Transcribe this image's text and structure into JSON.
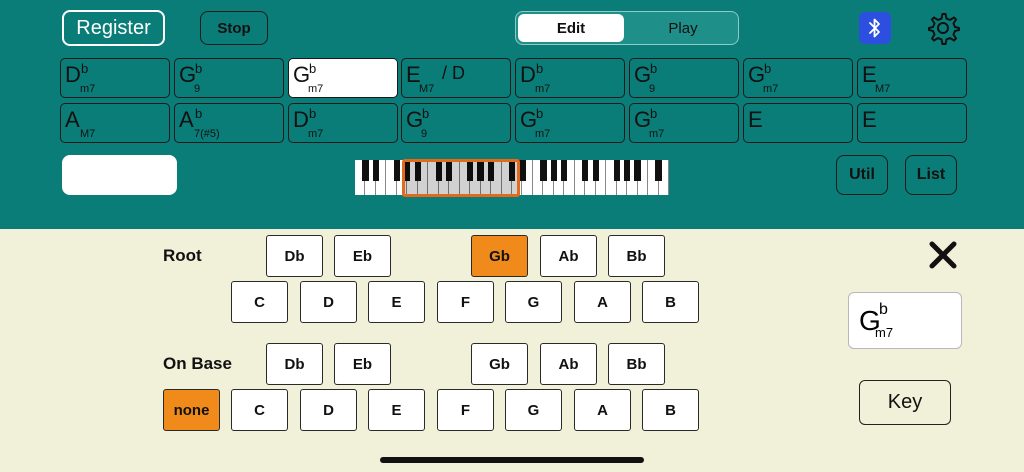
{
  "header": {
    "register_label": "Register",
    "stop_label": "Stop",
    "mode": {
      "options": [
        "Edit",
        "Play"
      ],
      "selected": "Edit"
    },
    "util_label": "Util",
    "list_label": "List"
  },
  "chords": [
    [
      {
        "root": "D",
        "acc": "b",
        "qual": "m7"
      },
      {
        "root": "G",
        "acc": "b",
        "qual": "9"
      },
      {
        "root": "G",
        "acc": "b",
        "qual": "m7",
        "selected": true
      },
      {
        "root": "E",
        "acc": "",
        "qual": "M7",
        "slash": "/ D"
      },
      {
        "root": "D",
        "acc": "b",
        "qual": "m7"
      },
      {
        "root": "G",
        "acc": "b",
        "qual": "9"
      },
      {
        "root": "G",
        "acc": "b",
        "qual": "m7"
      },
      {
        "root": "E",
        "acc": "",
        "qual": "M7"
      }
    ],
    [
      {
        "root": "A",
        "acc": "",
        "qual": "M7"
      },
      {
        "root": "A",
        "acc": "b",
        "qual": "7(#5)"
      },
      {
        "root": "D",
        "acc": "b",
        "qual": "m7"
      },
      {
        "root": "G",
        "acc": "b",
        "qual": "9"
      },
      {
        "root": "G",
        "acc": "b",
        "qual": "m7"
      },
      {
        "root": "G",
        "acc": "b",
        "qual": "m7"
      },
      {
        "root": "E",
        "acc": "",
        "qual": ""
      },
      {
        "root": "E",
        "acc": "",
        "qual": ""
      }
    ]
  ],
  "root_section": {
    "label": "Root",
    "sharps": [
      "Db",
      "Eb",
      "Gb",
      "Ab",
      "Bb"
    ],
    "naturals": [
      "C",
      "D",
      "E",
      "F",
      "G",
      "A",
      "B"
    ],
    "selected": "Gb"
  },
  "onbase_section": {
    "label": "On Base",
    "sharps": [
      "Db",
      "Eb",
      "Gb",
      "Ab",
      "Bb"
    ],
    "naturals": [
      "C",
      "D",
      "E",
      "F",
      "G",
      "A",
      "B"
    ],
    "none_label": "none",
    "selected": "none"
  },
  "preview": {
    "root": "G",
    "acc": "b",
    "qual": "m7"
  },
  "key_label": "Key",
  "colors": {
    "teal": "#0a7d78",
    "cream": "#f1f0d8",
    "orange": "#f08a1a",
    "bluetooth": "#2d4fe0",
    "range": "#e36a1c"
  }
}
